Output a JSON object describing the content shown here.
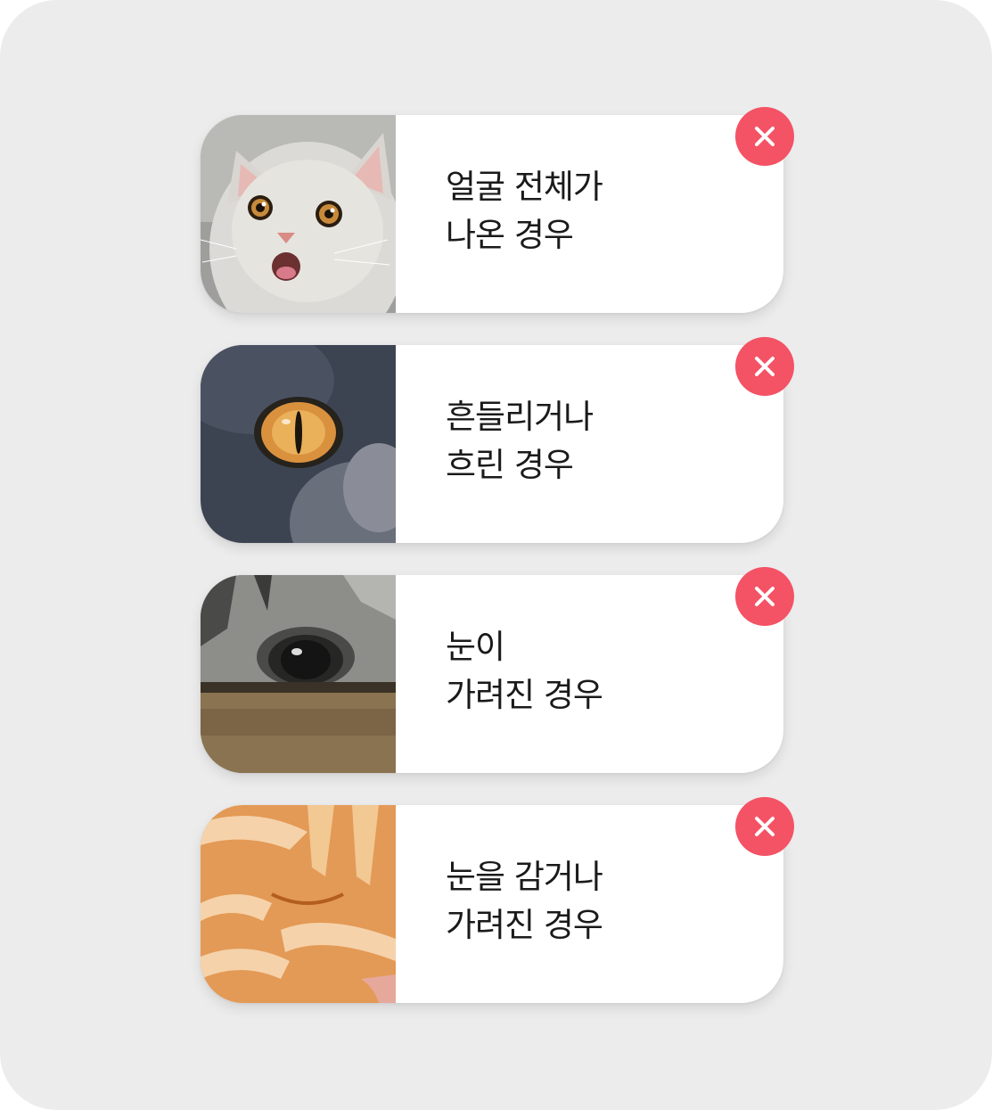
{
  "cards": [
    {
      "lines": [
        "얼굴 전체가",
        "나온 경우"
      ],
      "photo": "white-cat-full-face",
      "icon": "close-icon"
    },
    {
      "lines": [
        "흔들리거나",
        "흐린 경우"
      ],
      "photo": "blurry-dark-cat-eye",
      "icon": "close-icon"
    },
    {
      "lines": [
        "눈이",
        "가려진 경우"
      ],
      "photo": "tabby-cat-eye-hidden-behind-box",
      "icon": "close-icon"
    },
    {
      "lines": [
        "눈을 감거나",
        "가려진 경우"
      ],
      "photo": "orange-cat-eyes-closed",
      "icon": "close-icon"
    }
  ],
  "colors": {
    "background": "#ececec",
    "card": "#ffffff",
    "badge": "#f45265",
    "text": "#1a1a1a"
  }
}
